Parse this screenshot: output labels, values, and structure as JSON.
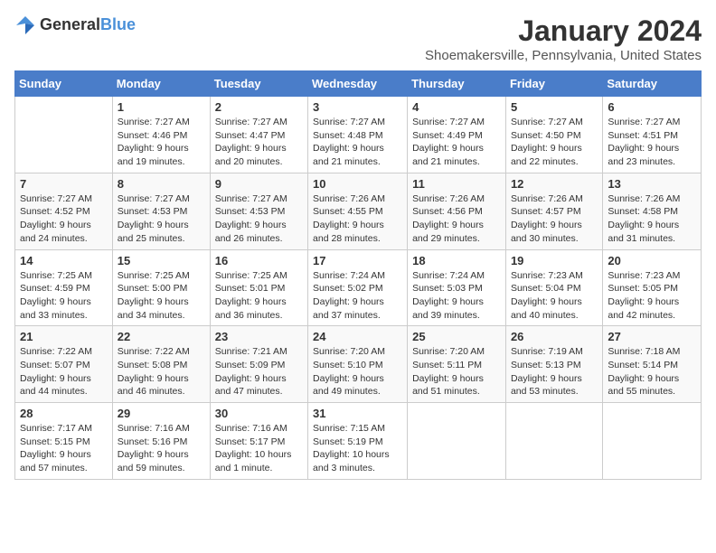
{
  "logo": {
    "text_general": "General",
    "text_blue": "Blue"
  },
  "header": {
    "month_year": "January 2024",
    "location": "Shoemakersville, Pennsylvania, United States"
  },
  "days_of_week": [
    "Sunday",
    "Monday",
    "Tuesday",
    "Wednesday",
    "Thursday",
    "Friday",
    "Saturday"
  ],
  "weeks": [
    [
      {
        "day": "",
        "sunrise": "",
        "sunset": "",
        "daylight": ""
      },
      {
        "day": "1",
        "sunrise": "Sunrise: 7:27 AM",
        "sunset": "Sunset: 4:46 PM",
        "daylight": "Daylight: 9 hours and 19 minutes."
      },
      {
        "day": "2",
        "sunrise": "Sunrise: 7:27 AM",
        "sunset": "Sunset: 4:47 PM",
        "daylight": "Daylight: 9 hours and 20 minutes."
      },
      {
        "day": "3",
        "sunrise": "Sunrise: 7:27 AM",
        "sunset": "Sunset: 4:48 PM",
        "daylight": "Daylight: 9 hours and 21 minutes."
      },
      {
        "day": "4",
        "sunrise": "Sunrise: 7:27 AM",
        "sunset": "Sunset: 4:49 PM",
        "daylight": "Daylight: 9 hours and 21 minutes."
      },
      {
        "day": "5",
        "sunrise": "Sunrise: 7:27 AM",
        "sunset": "Sunset: 4:50 PM",
        "daylight": "Daylight: 9 hours and 22 minutes."
      },
      {
        "day": "6",
        "sunrise": "Sunrise: 7:27 AM",
        "sunset": "Sunset: 4:51 PM",
        "daylight": "Daylight: 9 hours and 23 minutes."
      }
    ],
    [
      {
        "day": "7",
        "sunrise": "Sunrise: 7:27 AM",
        "sunset": "Sunset: 4:52 PM",
        "daylight": "Daylight: 9 hours and 24 minutes."
      },
      {
        "day": "8",
        "sunrise": "Sunrise: 7:27 AM",
        "sunset": "Sunset: 4:53 PM",
        "daylight": "Daylight: 9 hours and 25 minutes."
      },
      {
        "day": "9",
        "sunrise": "Sunrise: 7:27 AM",
        "sunset": "Sunset: 4:53 PM",
        "daylight": "Daylight: 9 hours and 26 minutes."
      },
      {
        "day": "10",
        "sunrise": "Sunrise: 7:26 AM",
        "sunset": "Sunset: 4:55 PM",
        "daylight": "Daylight: 9 hours and 28 minutes."
      },
      {
        "day": "11",
        "sunrise": "Sunrise: 7:26 AM",
        "sunset": "Sunset: 4:56 PM",
        "daylight": "Daylight: 9 hours and 29 minutes."
      },
      {
        "day": "12",
        "sunrise": "Sunrise: 7:26 AM",
        "sunset": "Sunset: 4:57 PM",
        "daylight": "Daylight: 9 hours and 30 minutes."
      },
      {
        "day": "13",
        "sunrise": "Sunrise: 7:26 AM",
        "sunset": "Sunset: 4:58 PM",
        "daylight": "Daylight: 9 hours and 31 minutes."
      }
    ],
    [
      {
        "day": "14",
        "sunrise": "Sunrise: 7:25 AM",
        "sunset": "Sunset: 4:59 PM",
        "daylight": "Daylight: 9 hours and 33 minutes."
      },
      {
        "day": "15",
        "sunrise": "Sunrise: 7:25 AM",
        "sunset": "Sunset: 5:00 PM",
        "daylight": "Daylight: 9 hours and 34 minutes."
      },
      {
        "day": "16",
        "sunrise": "Sunrise: 7:25 AM",
        "sunset": "Sunset: 5:01 PM",
        "daylight": "Daylight: 9 hours and 36 minutes."
      },
      {
        "day": "17",
        "sunrise": "Sunrise: 7:24 AM",
        "sunset": "Sunset: 5:02 PM",
        "daylight": "Daylight: 9 hours and 37 minutes."
      },
      {
        "day": "18",
        "sunrise": "Sunrise: 7:24 AM",
        "sunset": "Sunset: 5:03 PM",
        "daylight": "Daylight: 9 hours and 39 minutes."
      },
      {
        "day": "19",
        "sunrise": "Sunrise: 7:23 AM",
        "sunset": "Sunset: 5:04 PM",
        "daylight": "Daylight: 9 hours and 40 minutes."
      },
      {
        "day": "20",
        "sunrise": "Sunrise: 7:23 AM",
        "sunset": "Sunset: 5:05 PM",
        "daylight": "Daylight: 9 hours and 42 minutes."
      }
    ],
    [
      {
        "day": "21",
        "sunrise": "Sunrise: 7:22 AM",
        "sunset": "Sunset: 5:07 PM",
        "daylight": "Daylight: 9 hours and 44 minutes."
      },
      {
        "day": "22",
        "sunrise": "Sunrise: 7:22 AM",
        "sunset": "Sunset: 5:08 PM",
        "daylight": "Daylight: 9 hours and 46 minutes."
      },
      {
        "day": "23",
        "sunrise": "Sunrise: 7:21 AM",
        "sunset": "Sunset: 5:09 PM",
        "daylight": "Daylight: 9 hours and 47 minutes."
      },
      {
        "day": "24",
        "sunrise": "Sunrise: 7:20 AM",
        "sunset": "Sunset: 5:10 PM",
        "daylight": "Daylight: 9 hours and 49 minutes."
      },
      {
        "day": "25",
        "sunrise": "Sunrise: 7:20 AM",
        "sunset": "Sunset: 5:11 PM",
        "daylight": "Daylight: 9 hours and 51 minutes."
      },
      {
        "day": "26",
        "sunrise": "Sunrise: 7:19 AM",
        "sunset": "Sunset: 5:13 PM",
        "daylight": "Daylight: 9 hours and 53 minutes."
      },
      {
        "day": "27",
        "sunrise": "Sunrise: 7:18 AM",
        "sunset": "Sunset: 5:14 PM",
        "daylight": "Daylight: 9 hours and 55 minutes."
      }
    ],
    [
      {
        "day": "28",
        "sunrise": "Sunrise: 7:17 AM",
        "sunset": "Sunset: 5:15 PM",
        "daylight": "Daylight: 9 hours and 57 minutes."
      },
      {
        "day": "29",
        "sunrise": "Sunrise: 7:16 AM",
        "sunset": "Sunset: 5:16 PM",
        "daylight": "Daylight: 9 hours and 59 minutes."
      },
      {
        "day": "30",
        "sunrise": "Sunrise: 7:16 AM",
        "sunset": "Sunset: 5:17 PM",
        "daylight": "Daylight: 10 hours and 1 minute."
      },
      {
        "day": "31",
        "sunrise": "Sunrise: 7:15 AM",
        "sunset": "Sunset: 5:19 PM",
        "daylight": "Daylight: 10 hours and 3 minutes."
      },
      {
        "day": "",
        "sunrise": "",
        "sunset": "",
        "daylight": ""
      },
      {
        "day": "",
        "sunrise": "",
        "sunset": "",
        "daylight": ""
      },
      {
        "day": "",
        "sunrise": "",
        "sunset": "",
        "daylight": ""
      }
    ]
  ]
}
